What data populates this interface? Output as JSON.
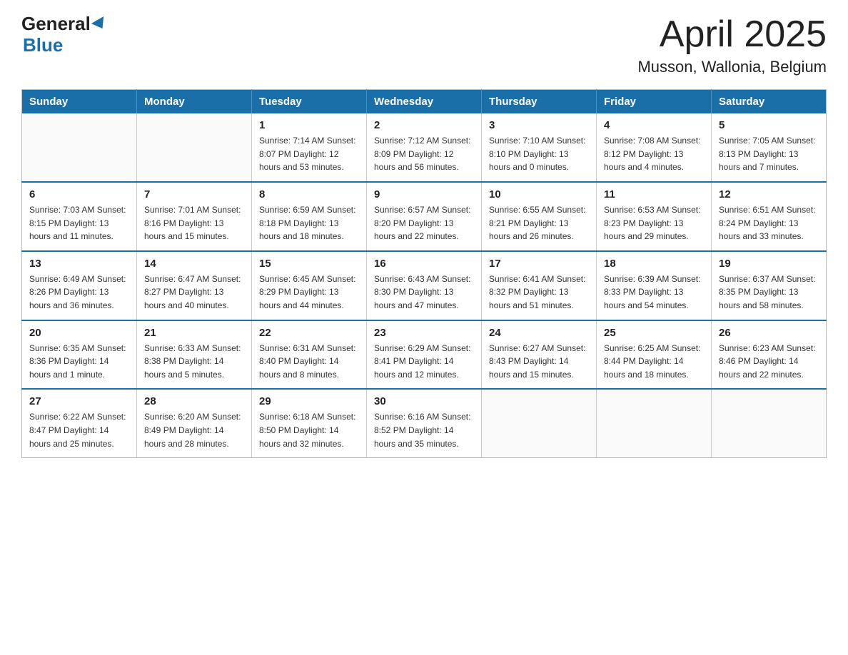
{
  "logo": {
    "general": "General",
    "blue": "Blue"
  },
  "title": "April 2025",
  "subtitle": "Musson, Wallonia, Belgium",
  "days_of_week": [
    "Sunday",
    "Monday",
    "Tuesday",
    "Wednesday",
    "Thursday",
    "Friday",
    "Saturday"
  ],
  "weeks": [
    [
      {
        "day": "",
        "info": ""
      },
      {
        "day": "",
        "info": ""
      },
      {
        "day": "1",
        "info": "Sunrise: 7:14 AM\nSunset: 8:07 PM\nDaylight: 12 hours\nand 53 minutes."
      },
      {
        "day": "2",
        "info": "Sunrise: 7:12 AM\nSunset: 8:09 PM\nDaylight: 12 hours\nand 56 minutes."
      },
      {
        "day": "3",
        "info": "Sunrise: 7:10 AM\nSunset: 8:10 PM\nDaylight: 13 hours\nand 0 minutes."
      },
      {
        "day": "4",
        "info": "Sunrise: 7:08 AM\nSunset: 8:12 PM\nDaylight: 13 hours\nand 4 minutes."
      },
      {
        "day": "5",
        "info": "Sunrise: 7:05 AM\nSunset: 8:13 PM\nDaylight: 13 hours\nand 7 minutes."
      }
    ],
    [
      {
        "day": "6",
        "info": "Sunrise: 7:03 AM\nSunset: 8:15 PM\nDaylight: 13 hours\nand 11 minutes."
      },
      {
        "day": "7",
        "info": "Sunrise: 7:01 AM\nSunset: 8:16 PM\nDaylight: 13 hours\nand 15 minutes."
      },
      {
        "day": "8",
        "info": "Sunrise: 6:59 AM\nSunset: 8:18 PM\nDaylight: 13 hours\nand 18 minutes."
      },
      {
        "day": "9",
        "info": "Sunrise: 6:57 AM\nSunset: 8:20 PM\nDaylight: 13 hours\nand 22 minutes."
      },
      {
        "day": "10",
        "info": "Sunrise: 6:55 AM\nSunset: 8:21 PM\nDaylight: 13 hours\nand 26 minutes."
      },
      {
        "day": "11",
        "info": "Sunrise: 6:53 AM\nSunset: 8:23 PM\nDaylight: 13 hours\nand 29 minutes."
      },
      {
        "day": "12",
        "info": "Sunrise: 6:51 AM\nSunset: 8:24 PM\nDaylight: 13 hours\nand 33 minutes."
      }
    ],
    [
      {
        "day": "13",
        "info": "Sunrise: 6:49 AM\nSunset: 8:26 PM\nDaylight: 13 hours\nand 36 minutes."
      },
      {
        "day": "14",
        "info": "Sunrise: 6:47 AM\nSunset: 8:27 PM\nDaylight: 13 hours\nand 40 minutes."
      },
      {
        "day": "15",
        "info": "Sunrise: 6:45 AM\nSunset: 8:29 PM\nDaylight: 13 hours\nand 44 minutes."
      },
      {
        "day": "16",
        "info": "Sunrise: 6:43 AM\nSunset: 8:30 PM\nDaylight: 13 hours\nand 47 minutes."
      },
      {
        "day": "17",
        "info": "Sunrise: 6:41 AM\nSunset: 8:32 PM\nDaylight: 13 hours\nand 51 minutes."
      },
      {
        "day": "18",
        "info": "Sunrise: 6:39 AM\nSunset: 8:33 PM\nDaylight: 13 hours\nand 54 minutes."
      },
      {
        "day": "19",
        "info": "Sunrise: 6:37 AM\nSunset: 8:35 PM\nDaylight: 13 hours\nand 58 minutes."
      }
    ],
    [
      {
        "day": "20",
        "info": "Sunrise: 6:35 AM\nSunset: 8:36 PM\nDaylight: 14 hours\nand 1 minute."
      },
      {
        "day": "21",
        "info": "Sunrise: 6:33 AM\nSunset: 8:38 PM\nDaylight: 14 hours\nand 5 minutes."
      },
      {
        "day": "22",
        "info": "Sunrise: 6:31 AM\nSunset: 8:40 PM\nDaylight: 14 hours\nand 8 minutes."
      },
      {
        "day": "23",
        "info": "Sunrise: 6:29 AM\nSunset: 8:41 PM\nDaylight: 14 hours\nand 12 minutes."
      },
      {
        "day": "24",
        "info": "Sunrise: 6:27 AM\nSunset: 8:43 PM\nDaylight: 14 hours\nand 15 minutes."
      },
      {
        "day": "25",
        "info": "Sunrise: 6:25 AM\nSunset: 8:44 PM\nDaylight: 14 hours\nand 18 minutes."
      },
      {
        "day": "26",
        "info": "Sunrise: 6:23 AM\nSunset: 8:46 PM\nDaylight: 14 hours\nand 22 minutes."
      }
    ],
    [
      {
        "day": "27",
        "info": "Sunrise: 6:22 AM\nSunset: 8:47 PM\nDaylight: 14 hours\nand 25 minutes."
      },
      {
        "day": "28",
        "info": "Sunrise: 6:20 AM\nSunset: 8:49 PM\nDaylight: 14 hours\nand 28 minutes."
      },
      {
        "day": "29",
        "info": "Sunrise: 6:18 AM\nSunset: 8:50 PM\nDaylight: 14 hours\nand 32 minutes."
      },
      {
        "day": "30",
        "info": "Sunrise: 6:16 AM\nSunset: 8:52 PM\nDaylight: 14 hours\nand 35 minutes."
      },
      {
        "day": "",
        "info": ""
      },
      {
        "day": "",
        "info": ""
      },
      {
        "day": "",
        "info": ""
      }
    ]
  ]
}
